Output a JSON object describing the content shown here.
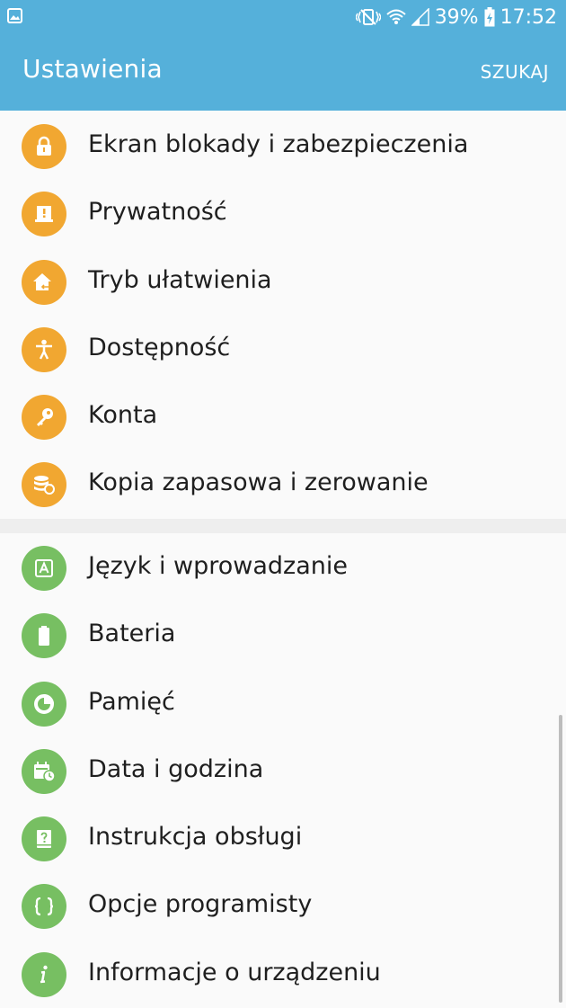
{
  "status_bar": {
    "battery_percent": "39%",
    "time": "17:52",
    "icons": [
      "gallery-notification-icon",
      "vibrate-mute-icon",
      "wifi-icon",
      "signal-icon",
      "battery-charging-icon"
    ]
  },
  "app_bar": {
    "title": "Ustawienia",
    "search_label": "SZUKAJ",
    "color": "#55b0da"
  },
  "groups": [
    {
      "color": "#f1a731",
      "items": [
        {
          "label": "Ekran blokady i zabezpieczenia",
          "icon": "lock-icon"
        },
        {
          "label": "Prywatność",
          "icon": "privacy-alert-icon"
        },
        {
          "label": "Tryb ułatwienia",
          "icon": "easy-mode-home-icon"
        },
        {
          "label": "Dostępność",
          "icon": "accessibility-person-icon"
        },
        {
          "label": "Konta",
          "icon": "key-icon"
        },
        {
          "label": "Kopia zapasowa i zerowanie",
          "icon": "backup-restore-icon"
        }
      ]
    },
    {
      "color": "#77bf62",
      "items": [
        {
          "label": "Język i wprowadzanie",
          "icon": "language-input-icon"
        },
        {
          "label": "Bateria",
          "icon": "battery-icon"
        },
        {
          "label": "Pamięć",
          "icon": "storage-pie-icon"
        },
        {
          "label": "Data i godzina",
          "icon": "calendar-clock-icon"
        },
        {
          "label": "Instrukcja obsługi",
          "icon": "user-manual-icon"
        },
        {
          "label": "Opcje programisty",
          "icon": "developer-braces-icon"
        },
        {
          "label": "Informacje o urządzeniu",
          "icon": "info-icon"
        }
      ]
    }
  ]
}
